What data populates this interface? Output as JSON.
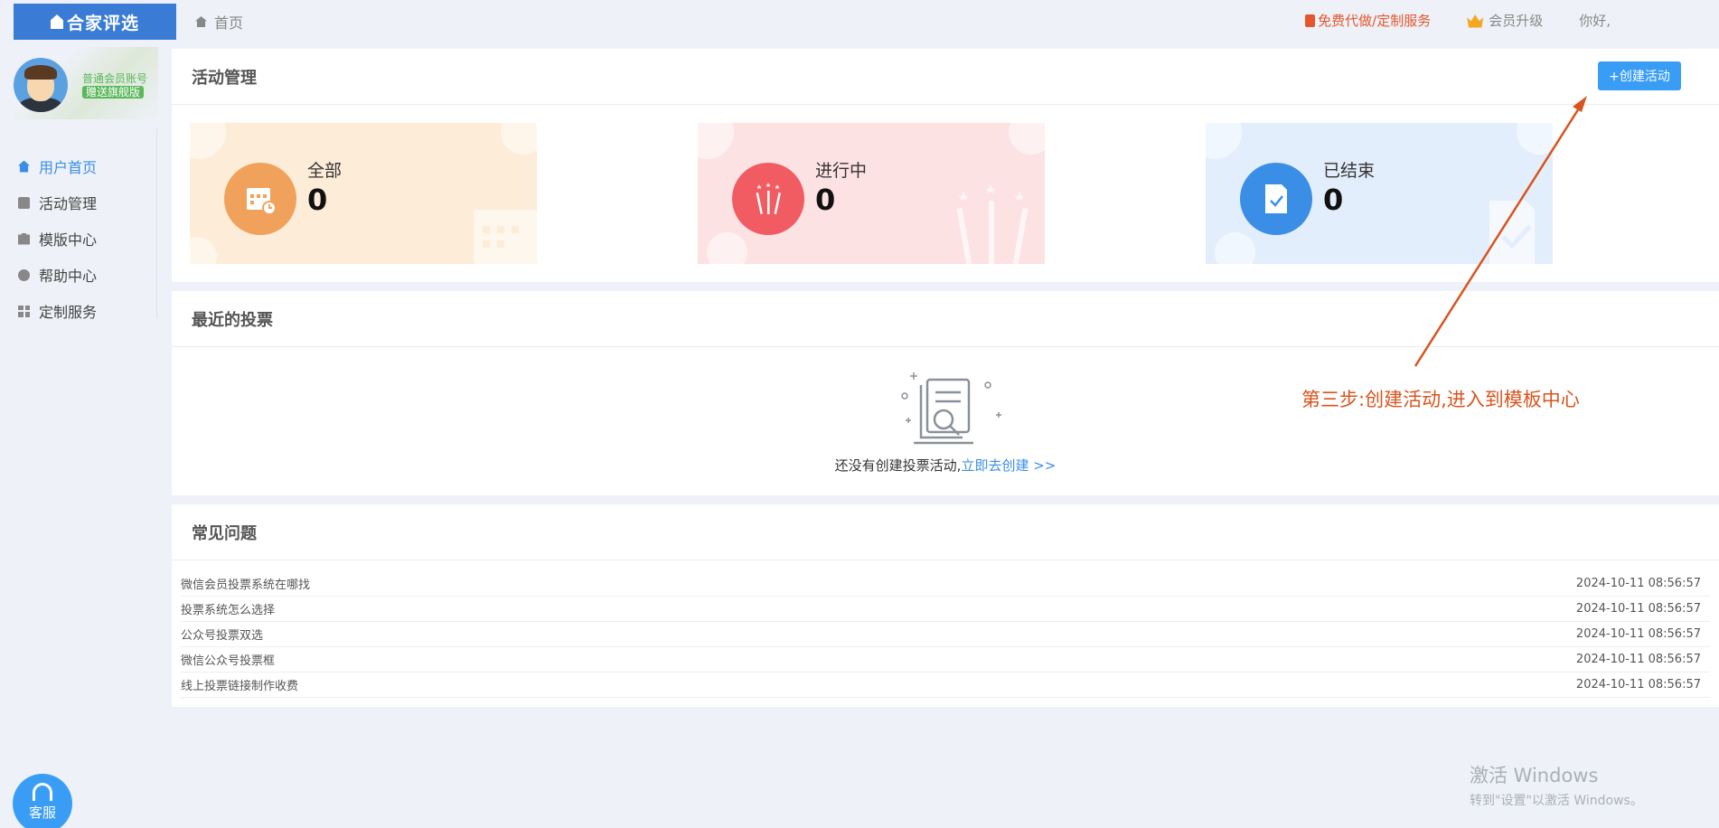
{
  "header": {
    "logo_text": "合家评选",
    "breadcrumb": "首页",
    "free_service": "免费代做/定制服务",
    "vip_upgrade": "会员升级",
    "greeting": "你好,"
  },
  "profile": {
    "line1": "普通会员账号",
    "badge": "赠送旗舰版"
  },
  "sidebar": {
    "items": [
      {
        "label": "用户首页",
        "icon": "home-icon"
      },
      {
        "label": "活动管理",
        "icon": "clipboard-icon"
      },
      {
        "label": "模版中心",
        "icon": "template-icon"
      },
      {
        "label": "帮助中心",
        "icon": "help-icon"
      },
      {
        "label": "定制服务",
        "icon": "grid-icon"
      }
    ]
  },
  "activity": {
    "title": "活动管理",
    "create_button": "+创建活动",
    "cards": [
      {
        "label": "全部",
        "count": "0",
        "icon": "calendar-icon"
      },
      {
        "label": "进行中",
        "count": "0",
        "icon": "fireworks-icon"
      },
      {
        "label": "已结束",
        "count": "0",
        "icon": "check-doc-icon"
      }
    ]
  },
  "recent": {
    "title": "最近的投票",
    "empty_text": "还没有创建投票活动,",
    "empty_link": "立即去创建 >>"
  },
  "faq": {
    "title": "常见问题",
    "rows": [
      {
        "q": "微信会员投票系统在哪找",
        "date": "2024-10-11 08:56:57"
      },
      {
        "q": "投票系统怎么选择",
        "date": "2024-10-11 08:56:57"
      },
      {
        "q": "公众号投票双选",
        "date": "2024-10-11 08:56:57"
      },
      {
        "q": "微信公众号投票框",
        "date": "2024-10-11 08:56:57"
      },
      {
        "q": "线上投票链接制作收费",
        "date": "2024-10-11 08:56:57"
      }
    ]
  },
  "annotation": "第三步:创建活动,进入到模板中心",
  "service_label": "客服",
  "watermark": {
    "line1": "激活 Windows",
    "line2": "转到\"设置\"以激活 Windows。"
  },
  "colors": {
    "accent": "#3a9df5",
    "annotation": "#d9541e",
    "card_all": "#fdecd7",
    "card_going": "#fde2e4",
    "card_done": "#e3eefc"
  }
}
